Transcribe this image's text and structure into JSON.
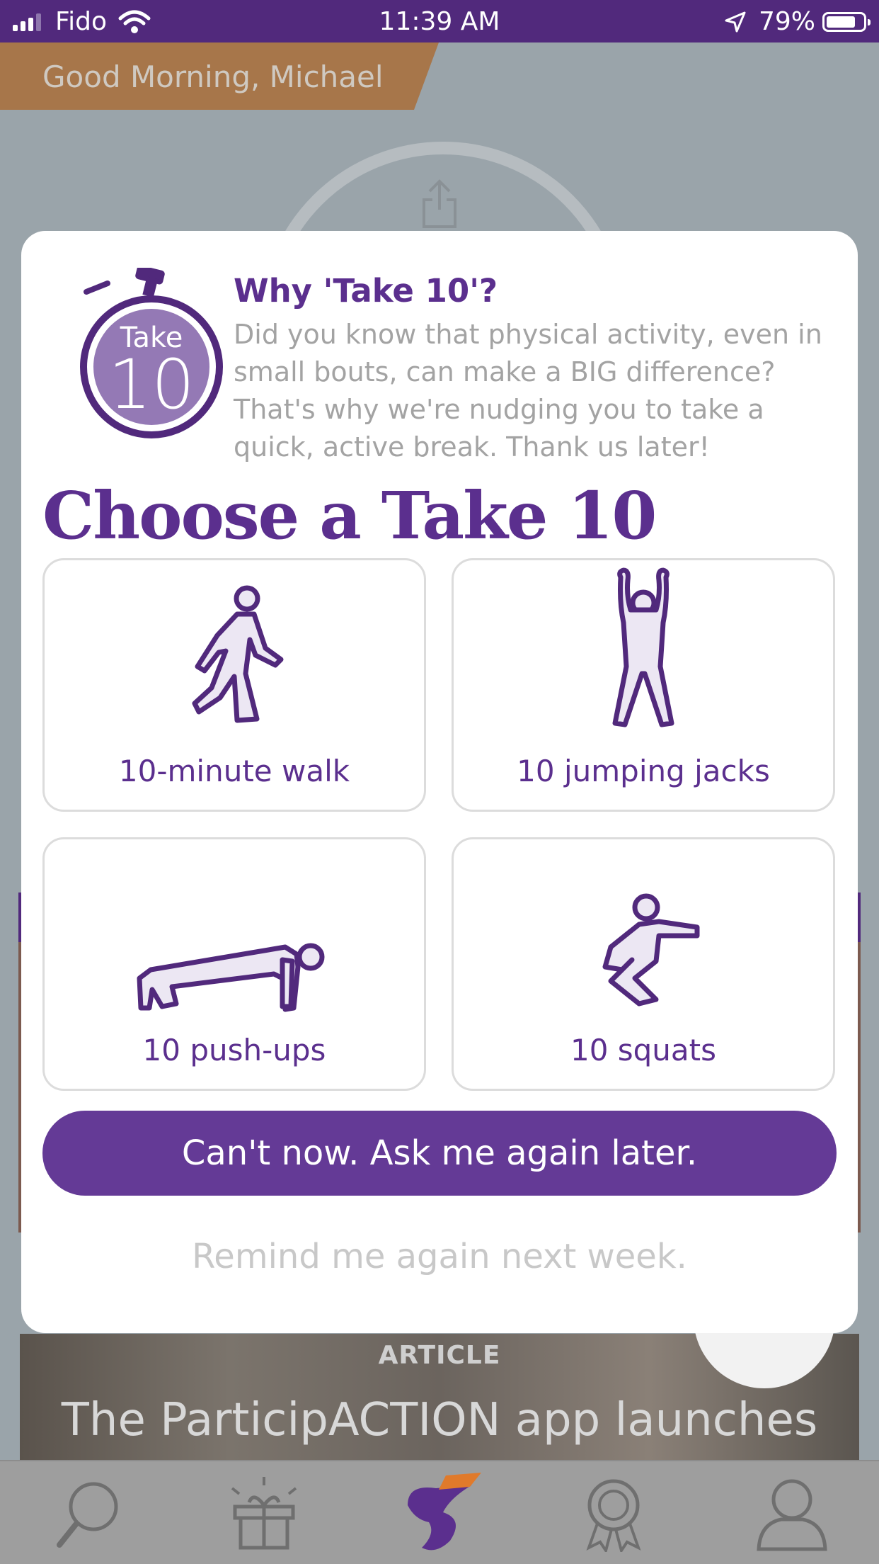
{
  "status_bar": {
    "carrier": "Fido",
    "time": "11:39 AM",
    "battery_percent": "79%",
    "battery_level": 0.79
  },
  "background": {
    "greeting": "Good Morning, Michael",
    "article_label": "ARTICLE",
    "article_title": "The ParticipACTION app launches"
  },
  "modal": {
    "logo": {
      "top": "Take",
      "number": "10"
    },
    "why_title": "Why 'Take 10'?",
    "why_body": "Did you know that physical activity, even in small bouts, can make a BIG difference? That's why we're nudging you to take a quick, active break. Thank us later!",
    "choose_heading": "Choose a Take 10",
    "options": [
      {
        "label": "10-minute walk",
        "icon": "walking-figure-icon"
      },
      {
        "label": "10 jumping jacks",
        "icon": "jumping-jack-figure-icon"
      },
      {
        "label": "10 push-ups",
        "icon": "push-up-figure-icon"
      },
      {
        "label": "10 squats",
        "icon": "squat-figure-icon"
      }
    ],
    "later_button": "Can't now. Ask me again later.",
    "week_link": "Remind me again next week."
  },
  "tabbar": {
    "icons": [
      "search-icon",
      "gift-icon",
      "participaction-logo-icon",
      "badge-icon",
      "profile-icon"
    ]
  },
  "colors": {
    "brand_purple": "#5b2f8e",
    "status_bar": "#51297c",
    "greeting_band": "#a7764a"
  }
}
